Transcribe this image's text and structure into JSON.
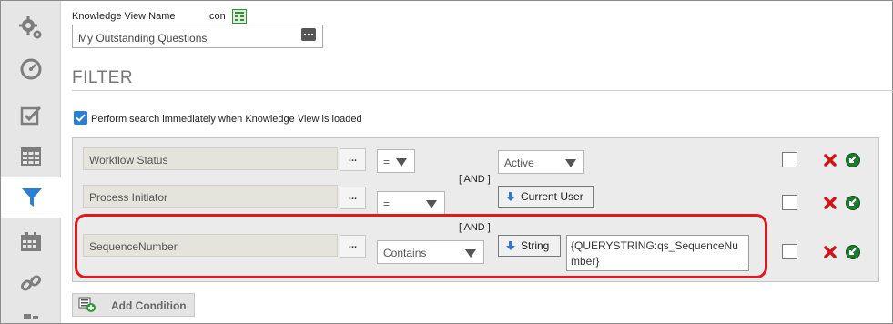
{
  "header": {
    "name_label": "Knowledge View Name",
    "icon_label": "Icon",
    "name_value": "My Outstanding Questions"
  },
  "filter": {
    "title": "FILTER",
    "immediate_search": {
      "checked": true,
      "label": "Perform search immediately when Knowledge View is loaded"
    },
    "and_label": "[ AND ]",
    "conditions": [
      {
        "field": "Workflow Status",
        "ellipsis": "...",
        "operator": "=",
        "value_type": "select",
        "value": "Active",
        "selected": false
      },
      {
        "field": "Process Initiator",
        "ellipsis": "...",
        "operator": "=",
        "value_type": "button",
        "value": "Current User",
        "selected": false
      },
      {
        "field": "SequenceNumber",
        "ellipsis": "...",
        "operator": "Contains",
        "value_type": "button",
        "value": "String",
        "text_value": "{QUERYSTRING:qs_SequenceNumber}",
        "selected": false
      }
    ],
    "add_condition_label": "Add Condition"
  },
  "rail": {
    "items": [
      "settings-gears-icon",
      "dashboard-gauge-icon",
      "checklist-icon",
      "table-grid-icon",
      "filter-funnel-icon",
      "calendar-icon",
      "link-icon",
      "more-icon"
    ],
    "active": "filter-funnel-icon"
  },
  "colors": {
    "accent": "#2a7fd4",
    "highlight": "#e0191f",
    "delete": "#d0141a",
    "confirm": "#1f7a2f"
  }
}
